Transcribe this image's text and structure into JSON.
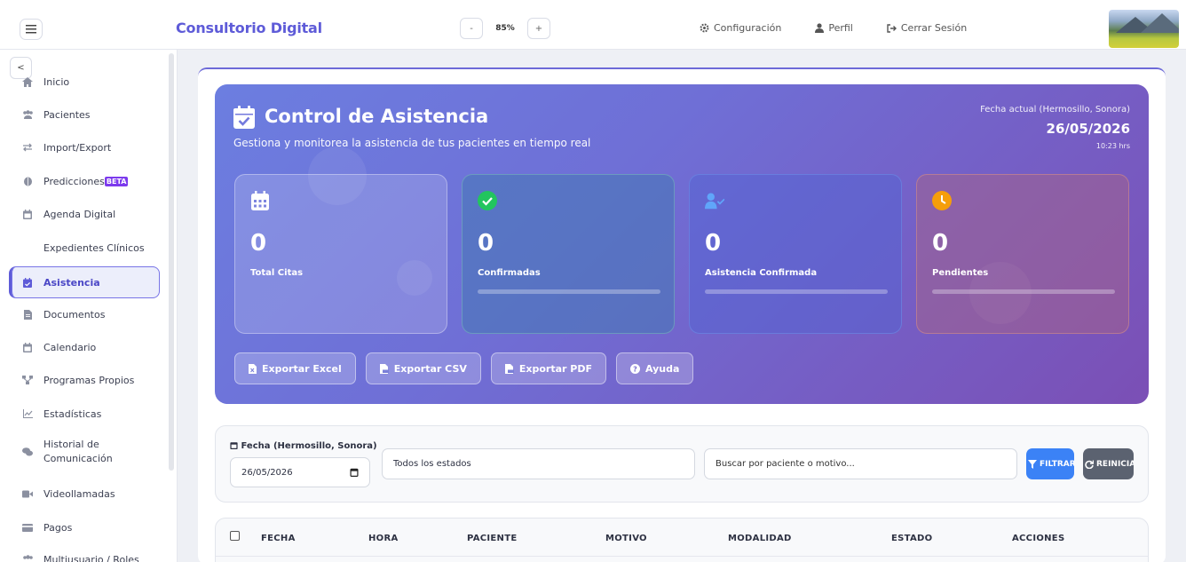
{
  "header": {
    "brand": "Consultorio Digital",
    "zoom_minus": "-",
    "zoom_value": "85%",
    "zoom_plus": "+",
    "nav": [
      {
        "label": "Configuración",
        "icon": "gear-icon"
      },
      {
        "label": "Perfil",
        "icon": "user-icon"
      },
      {
        "label": "Cerrar Sesión",
        "icon": "logout-icon"
      }
    ]
  },
  "sidebar": {
    "collapse_label": "<",
    "items": [
      {
        "label": "Inicio",
        "icon": "home-icon"
      },
      {
        "label": "Pacientes",
        "icon": "users-icon"
      },
      {
        "label": "Import/Export",
        "icon": "exchange-icon"
      },
      {
        "label": "Predicciones",
        "icon": "brain-icon",
        "badge": "BETA"
      },
      {
        "label": "Agenda Digital",
        "icon": "calendar-icon"
      },
      {
        "label": "Expedientes Clínicos",
        "icon": ""
      },
      {
        "label": "Asistencia",
        "icon": "calendar-check-icon",
        "active": true
      },
      {
        "label": "Documentos",
        "icon": "file-icon"
      },
      {
        "label": "Calendario",
        "icon": "calendar-icon"
      },
      {
        "label": "Programas Propios",
        "icon": "network-icon"
      },
      {
        "label": "Estadísticas",
        "icon": "chart-line-icon"
      },
      {
        "label": "Historial de Comunicación",
        "icon": "comments-icon"
      },
      {
        "label": "Videollamadas",
        "icon": "video-icon"
      },
      {
        "label": "Pagos",
        "icon": "credit-card-icon"
      },
      {
        "label": "Multiusuario / Roles",
        "icon": "users-cog-icon"
      }
    ]
  },
  "hero": {
    "title": "Control de Asistencia",
    "subtitle": "Gestiona y monitorea la asistencia de tus pacientes en tiempo real",
    "date_label": "Fecha actual (Hermosillo, Sonora)",
    "date": "26/05/2026",
    "time": "10:23 hrs"
  },
  "cards": [
    {
      "value": "0",
      "label": "Total Citas",
      "icon": "calendar-grid-icon",
      "color": "#ffffff"
    },
    {
      "value": "0",
      "label": "Confirmadas",
      "icon": "check-circle-icon",
      "color": "#22c55e",
      "progress": 0
    },
    {
      "value": "0",
      "label": "Asistencia Confirmada",
      "icon": "user-check-icon",
      "color": "#60a5fa",
      "progress": 0
    },
    {
      "value": "0",
      "label": "Pendientes",
      "icon": "clock-icon",
      "color": "#f59e0b",
      "progress": 0
    }
  ],
  "exports": [
    {
      "label": "Exportar Excel",
      "icon": "file-excel-icon"
    },
    {
      "label": "Exportar CSV",
      "icon": "file-csv-icon"
    },
    {
      "label": "Exportar PDF",
      "icon": "file-pdf-icon"
    },
    {
      "label": "Ayuda",
      "icon": "question-circle-icon"
    }
  ],
  "filters": {
    "date_label": "Fecha (Hermosillo, Sonora)",
    "date_value": "26/05/2026",
    "status_value": "Todos los estados",
    "search_placeholder": "Buscar por paciente o motivo...",
    "filter_label": "FILTRAR",
    "reset_label": "REINICIAR"
  },
  "table": {
    "columns": [
      "FECHA",
      "HORA",
      "PACIENTE",
      "MOTIVO",
      "MODALIDAD",
      "ESTADO",
      "ACCIONES"
    ]
  },
  "colors": {
    "accent": "#5e5bd8",
    "filter_button": "#3b82f6",
    "reset_button": "#5b6270"
  }
}
